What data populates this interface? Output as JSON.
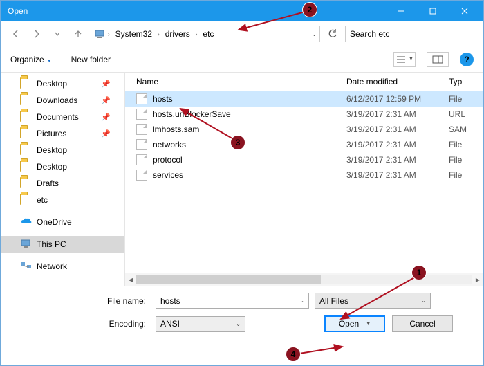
{
  "title": "Open",
  "breadcrumbs": {
    "b0": "System32",
    "b1": "drivers",
    "b2": "etc"
  },
  "search": {
    "placeholder": "Search etc"
  },
  "toolbar": {
    "organize": "Organize",
    "newfolder": "New folder"
  },
  "columns": {
    "name": "Name",
    "date": "Date modified",
    "type": "Typ"
  },
  "files": {
    "r0": {
      "name": "hosts",
      "date": "6/12/2017 12:59 PM",
      "type": "File"
    },
    "r1": {
      "name": "hosts.urlBlockerSave",
      "date": "3/19/2017 2:31 AM",
      "type": "URL"
    },
    "r2": {
      "name": "lmhosts.sam",
      "date": "3/19/2017 2:31 AM",
      "type": "SAM"
    },
    "r3": {
      "name": "networks",
      "date": "3/19/2017 2:31 AM",
      "type": "File"
    },
    "r4": {
      "name": "protocol",
      "date": "3/19/2017 2:31 AM",
      "type": "File"
    },
    "r5": {
      "name": "services",
      "date": "3/19/2017 2:31 AM",
      "type": "File"
    }
  },
  "sidebar": {
    "s0": "Desktop",
    "s1": "Downloads",
    "s2": "Documents",
    "s3": "Pictures",
    "s4": "Desktop",
    "s5": "Desktop",
    "s6": "Drafts",
    "s7": "etc",
    "s8": "OneDrive",
    "s9": "This PC",
    "s10": "Network"
  },
  "form": {
    "filename_label": "File name:",
    "filename_value": "hosts",
    "filter_value": "All Files",
    "encoding_label": "Encoding:",
    "encoding_value": "ANSI",
    "open": "Open",
    "cancel": "Cancel"
  },
  "callouts": {
    "c1": "1",
    "c2": "2",
    "c3": "3",
    "c4": "4"
  },
  "help": "?"
}
